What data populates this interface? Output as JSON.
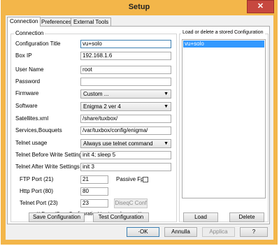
{
  "window": {
    "title": "Setup",
    "close_glyph": "✕"
  },
  "tabs": [
    {
      "label": "Connection",
      "active": true
    },
    {
      "label": "Preferences",
      "active": false
    },
    {
      "label": "External Tools",
      "active": false
    }
  ],
  "connection": {
    "group_title": "Connection",
    "fields": {
      "configuration_title": {
        "label": "Configuration Title",
        "value": "vu+solo"
      },
      "box_ip": {
        "label": "Box IP",
        "value": "192.168.1.6"
      },
      "user_name": {
        "label": "User Name",
        "value": "root"
      },
      "password": {
        "label": "Password",
        "value": ""
      },
      "firmware": {
        "label": "Firmware",
        "value": "Custom ..."
      },
      "software": {
        "label": "Software",
        "value": "Enigma 2 ver 4"
      },
      "satellites_xml": {
        "label": "Satellites.xml",
        "value": "/share/tuxbox/"
      },
      "services_bouquets": {
        "label": "Services,Bouquets",
        "value": "/var/tuxbox/config/enigma/"
      },
      "telnet_usage": {
        "label": "Telnet usage",
        "value": "Always use telnet command"
      },
      "telnet_before": {
        "label": "Telnet Before Write Settings",
        "value": "init 4; sleep 5"
      },
      "telnet_after": {
        "label": "Telnet After Write Settings",
        "value": "init 3"
      },
      "ftp_port": {
        "label": "FTP Port (21)",
        "value": "21"
      },
      "http_port": {
        "label": "Http Port (80)",
        "value": "80"
      },
      "telnet_port": {
        "label": "Telnet Port (23)",
        "value": "23"
      }
    },
    "passive_label": "Passive Fp",
    "passive_checked": false,
    "diseqc_button": "DiseqC Conf",
    "hint": "** Press 'Save Configuration' to store changes **",
    "save_button": "Save Configuration",
    "test_button": "Test Configuration"
  },
  "stored": {
    "group_title": "Load or delete a stored Configuration",
    "items": [
      "vu+solo"
    ],
    "load_button": "Load",
    "delete_button": "Delete"
  },
  "footer": {
    "ok": "·OK",
    "cancel": "Annulla",
    "apply": "Applica",
    "help": "?"
  },
  "colors": {
    "title_bar": "#f3b64a",
    "close_button": "#c7483f",
    "selection": "#3399ff"
  },
  "icons": {
    "dropdown": "chevron-down-icon",
    "close": "close-icon"
  }
}
